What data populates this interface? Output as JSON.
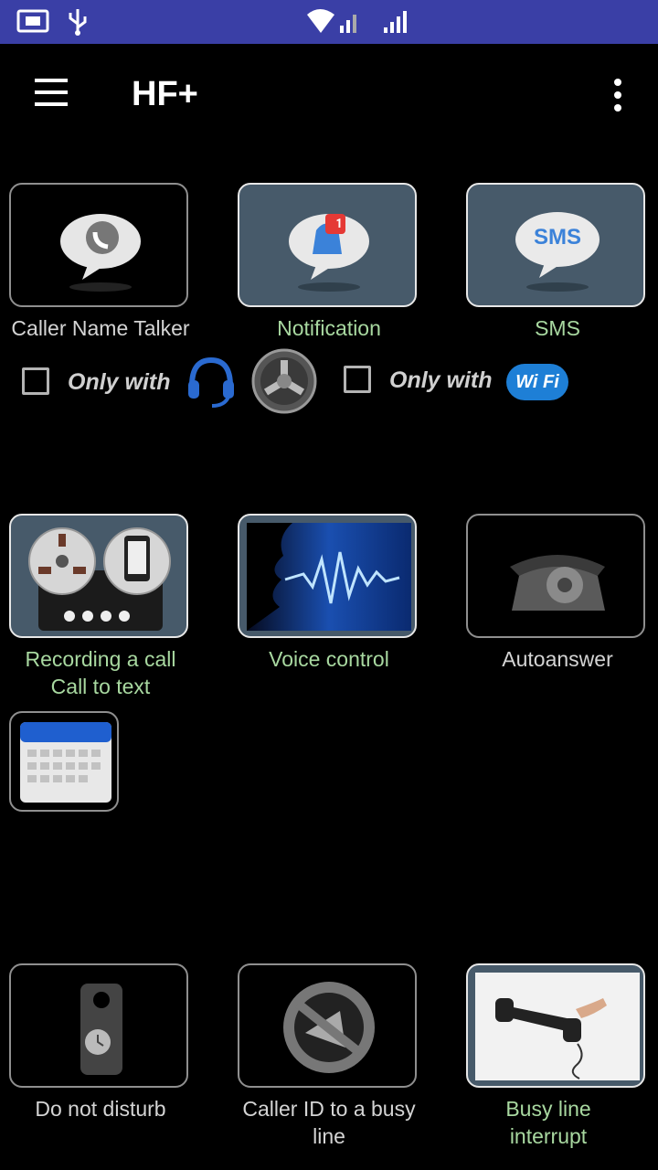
{
  "app": {
    "title": "HF+"
  },
  "status_bar": {
    "icons": [
      "screen-mirror-icon",
      "usb-icon",
      "wifi-signal-icon",
      "cell-signal-icon"
    ]
  },
  "tiles": [
    {
      "label": "Caller Name Talker",
      "icon": "caller-talker-icon",
      "active": false,
      "label_color": "grey"
    },
    {
      "label": "Notification",
      "icon": "notification-bell-icon",
      "active": true,
      "label_color": "green"
    },
    {
      "label": "SMS",
      "icon": "sms-bubble-icon",
      "active": true,
      "label_color": "green"
    },
    {
      "label": "Recording a call",
      "label2": "Call to text",
      "icon": "tape-recorder-icon",
      "active": true,
      "label_color": "green"
    },
    {
      "label": "Voice control",
      "icon": "voice-wave-icon",
      "active": true,
      "label_color": "green"
    },
    {
      "label": "Autoanswer",
      "icon": "rotary-phone-icon",
      "active": false,
      "label_color": "grey"
    },
    {
      "label": "",
      "icon": "calendar-icon",
      "active": false
    },
    {
      "label": "Do not disturb",
      "icon": "door-hanger-icon",
      "active": false,
      "label_color": "grey"
    },
    {
      "label": "Caller ID to a busy",
      "label2": "line",
      "icon": "megaphone-blocked-icon",
      "active": false,
      "label_color": "grey"
    },
    {
      "label": "Busy line",
      "label2": "interrupt",
      "icon": "phone-handset-icon",
      "active": true,
      "label_color": "green"
    }
  ],
  "options": {
    "headset_only_text": "Only with",
    "wifi_only_text": "Only with",
    "wifi_badge": "Wi Fi",
    "sms_badge": "SMS",
    "notification_count": "1"
  },
  "colors": {
    "status_bar": "#3a3fa6",
    "active_tile": "#475a6a",
    "active_label": "#a8d8a0",
    "inactive_label": "#d4d4d4"
  }
}
